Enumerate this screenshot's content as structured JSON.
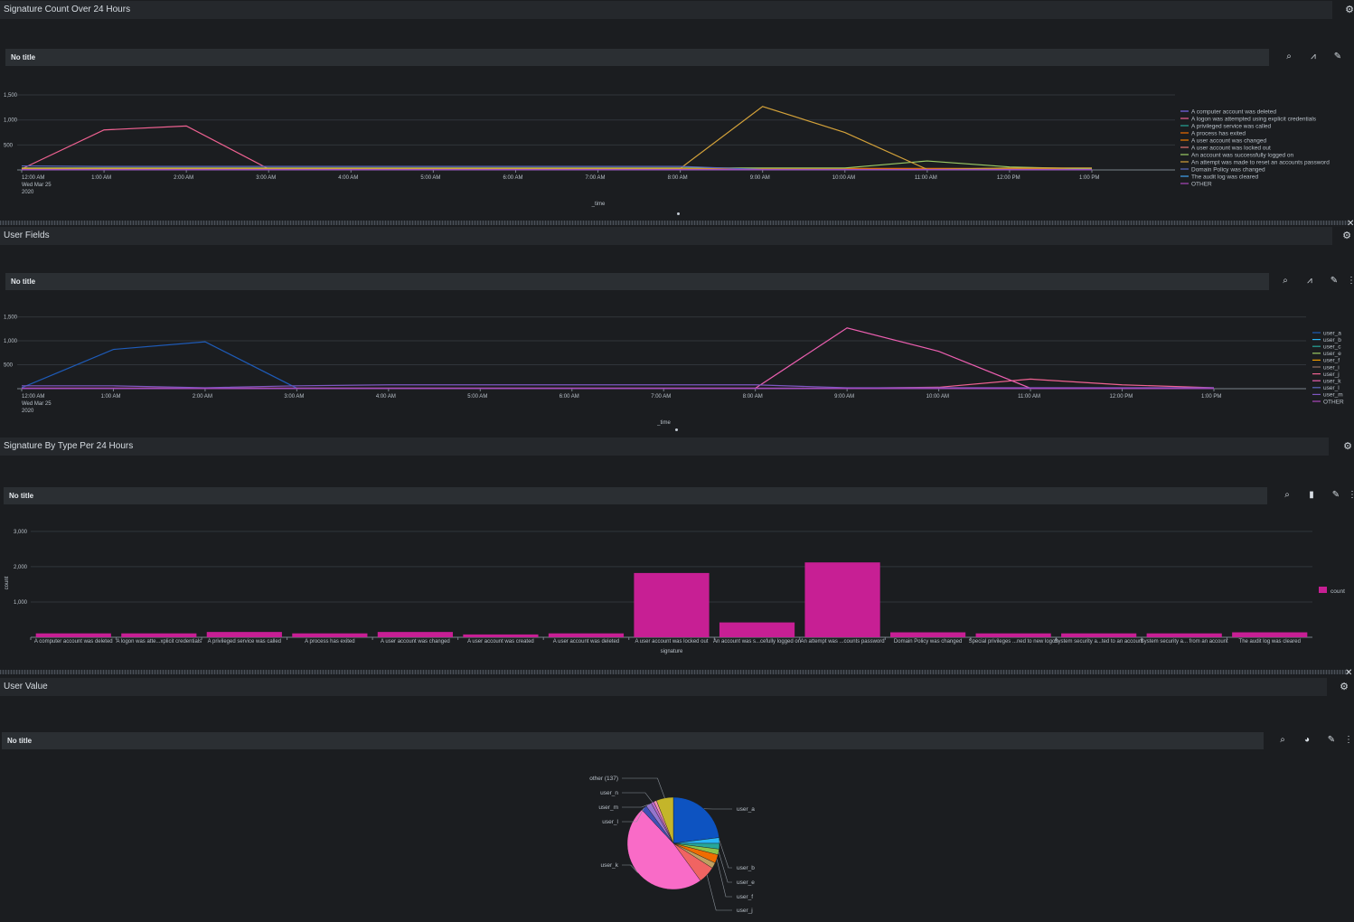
{
  "panels": {
    "p1": {
      "title": "Signature Count Over 24 Hours",
      "viz_title": "No title",
      "x_field": "_time",
      "x_ticks": [
        "12:00 AM",
        "1:00 AM",
        "2:00 AM",
        "3:00 AM",
        "4:00 AM",
        "5:00 AM",
        "6:00 AM",
        "7:00 AM",
        "8:00 AM",
        "9:00 AM",
        "10:00 AM",
        "11:00 AM",
        "12:00 PM",
        "1:00 PM"
      ],
      "x_tick_sub": [
        "Wed Mar 25",
        "2020"
      ],
      "y_ticks": [
        "500",
        "1,000",
        "1,500"
      ]
    },
    "p2": {
      "title": "User Fields",
      "viz_title": "No title",
      "x_field": "_time",
      "x_ticks": [
        "12:00 AM",
        "1:00 AM",
        "2:00 AM",
        "3:00 AM",
        "4:00 AM",
        "5:00 AM",
        "6:00 AM",
        "7:00 AM",
        "8:00 AM",
        "9:00 AM",
        "10:00 AM",
        "11:00 AM",
        "12:00 PM",
        "1:00 PM"
      ],
      "x_tick_sub": [
        "Wed Mar 25",
        "2020"
      ],
      "y_ticks": [
        "500",
        "1,000",
        "1,500"
      ]
    },
    "p3": {
      "title": "Signature By Type Per 24 Hours",
      "viz_title": "No title",
      "x_field": "signature",
      "y_field": "count",
      "y_ticks": [
        "1,000",
        "2,000",
        "3,000"
      ]
    },
    "p4": {
      "title": "User Value",
      "viz_title": "No title"
    }
  },
  "icons": {
    "settings": "gear-icon",
    "search": "search-icon",
    "chart_type_line": "line-chart-icon",
    "chart_type_bar": "bar-chart-icon",
    "chart_type_pie": "pie-chart-icon",
    "format": "paintbrush-icon",
    "more": "more-icon",
    "close": "close-icon"
  },
  "chart_data": [
    {
      "type": "line",
      "x": [
        "12:00 AM",
        "1:00 AM",
        "2:00 AM",
        "3:00 AM",
        "4:00 AM",
        "5:00 AM",
        "6:00 AM",
        "7:00 AM",
        "8:00 AM",
        "9:00 AM",
        "10:00 AM",
        "11:00 AM",
        "12:00 PM",
        "1:00 PM"
      ],
      "xlabel": "_time",
      "ylim": [
        0,
        1700
      ],
      "series": [
        {
          "name": "A computer account was deleted",
          "color": "#7b68ee",
          "values": [
            10,
            10,
            10,
            10,
            10,
            10,
            10,
            10,
            10,
            10,
            10,
            10,
            10,
            10
          ]
        },
        {
          "name": "A logon was attempted using explicit credentials",
          "color": "#f06292",
          "values": [
            20,
            800,
            880,
            20,
            20,
            20,
            20,
            20,
            20,
            20,
            20,
            20,
            20,
            20
          ]
        },
        {
          "name": "A privileged service was called",
          "color": "#26a69a",
          "values": [
            15,
            15,
            15,
            15,
            15,
            15,
            15,
            15,
            15,
            15,
            15,
            15,
            15,
            15
          ]
        },
        {
          "name": "A process has exited",
          "color": "#ef6c00",
          "values": [
            30,
            30,
            30,
            30,
            30,
            30,
            30,
            30,
            30,
            30,
            30,
            30,
            30,
            30
          ]
        },
        {
          "name": "A user account was changed",
          "color": "#f57c00",
          "values": [
            5,
            5,
            5,
            5,
            5,
            5,
            5,
            5,
            5,
            5,
            5,
            5,
            5,
            5
          ]
        },
        {
          "name": "A user account was locked out",
          "color": "#e57373",
          "values": [
            5,
            5,
            5,
            5,
            5,
            5,
            5,
            5,
            5,
            5,
            5,
            5,
            5,
            5
          ]
        },
        {
          "name": "An account was successfully logged on",
          "color": "#9ccc65",
          "values": [
            40,
            40,
            40,
            40,
            40,
            40,
            40,
            40,
            40,
            40,
            40,
            180,
            60,
            20
          ]
        },
        {
          "name": "An attempt was made to reset an accounts password",
          "color": "#d4a23a",
          "values": [
            30,
            30,
            30,
            30,
            30,
            30,
            30,
            30,
            30,
            1270,
            750,
            10,
            40,
            40
          ]
        },
        {
          "name": "Domain Policy was changed",
          "color": "#5c6bc0",
          "values": [
            80,
            70,
            70,
            70,
            70,
            70,
            70,
            70,
            70,
            10,
            10,
            10,
            10,
            10
          ]
        },
        {
          "name": "The audit log was cleared",
          "color": "#42a5f5",
          "values": [
            5,
            5,
            5,
            5,
            5,
            5,
            5,
            5,
            5,
            5,
            5,
            5,
            5,
            5
          ]
        },
        {
          "name": "OTHER",
          "color": "#ab47bc",
          "values": [
            5,
            5,
            5,
            5,
            5,
            5,
            5,
            5,
            5,
            5,
            5,
            5,
            5,
            5
          ]
        }
      ]
    },
    {
      "type": "line",
      "x": [
        "12:00 AM",
        "1:00 AM",
        "2:00 AM",
        "3:00 AM",
        "4:00 AM",
        "5:00 AM",
        "6:00 AM",
        "7:00 AM",
        "8:00 AM",
        "9:00 AM",
        "10:00 AM",
        "11:00 AM",
        "12:00 PM",
        "1:00 PM"
      ],
      "xlabel": "_time",
      "ylim": [
        0,
        1700
      ],
      "series": [
        {
          "name": "user_a",
          "color": "#1e5bb8",
          "values": [
            20,
            820,
            980,
            10,
            10,
            10,
            10,
            10,
            10,
            10,
            10,
            10,
            10,
            10
          ]
        },
        {
          "name": "user_b",
          "color": "#29b6f6",
          "values": [
            5,
            5,
            5,
            5,
            5,
            5,
            5,
            5,
            5,
            5,
            5,
            5,
            5,
            5
          ]
        },
        {
          "name": "user_c",
          "color": "#26a69a",
          "values": [
            5,
            5,
            5,
            5,
            5,
            5,
            5,
            5,
            5,
            5,
            5,
            5,
            5,
            5
          ]
        },
        {
          "name": "user_e",
          "color": "#9ccc65",
          "values": [
            5,
            5,
            5,
            5,
            5,
            5,
            5,
            5,
            5,
            5,
            5,
            5,
            5,
            5
          ]
        },
        {
          "name": "user_f",
          "color": "#ef9a00",
          "values": [
            5,
            5,
            5,
            5,
            5,
            5,
            5,
            5,
            5,
            5,
            5,
            5,
            5,
            5
          ]
        },
        {
          "name": "user_i",
          "color": "#8d6e63",
          "values": [
            5,
            5,
            5,
            5,
            5,
            5,
            5,
            5,
            5,
            5,
            5,
            5,
            5,
            5
          ]
        },
        {
          "name": "user_j",
          "color": "#f06292",
          "values": [
            10,
            10,
            10,
            10,
            10,
            10,
            10,
            10,
            10,
            10,
            30,
            200,
            80,
            20
          ]
        },
        {
          "name": "user_k",
          "color": "#ec5fb0",
          "values": [
            10,
            10,
            10,
            10,
            10,
            10,
            10,
            10,
            10,
            1270,
            780,
            10,
            10,
            10
          ]
        },
        {
          "name": "user_l",
          "color": "#5c6bc0",
          "values": [
            5,
            5,
            5,
            5,
            5,
            5,
            5,
            5,
            5,
            5,
            5,
            5,
            5,
            5
          ]
        },
        {
          "name": "user_m",
          "color": "#7e57c2",
          "values": [
            60,
            60,
            20,
            60,
            80,
            80,
            80,
            80,
            80,
            20,
            20,
            20,
            20,
            20
          ]
        },
        {
          "name": "OTHER",
          "color": "#ab47bc",
          "values": [
            5,
            5,
            5,
            5,
            5,
            5,
            5,
            5,
            5,
            5,
            5,
            5,
            5,
            5
          ]
        }
      ]
    },
    {
      "type": "bar",
      "categories": [
        "A computer account was deleted",
        "A logon was atte...xplicit credentials",
        "A privileged service was called",
        "A process has exited",
        "A user account was changed",
        "A user account was created",
        "A user account was deleted",
        "A user account was locked out",
        "An account was s...cefully logged on",
        "An attempt was ...counts password",
        "Domain Policy was changed",
        "Special privileges ...ned to new logon",
        "System security a...ted to an account",
        "System security a... from an account",
        "The audit log was cleared"
      ],
      "series": [
        {
          "name": "count",
          "color": "#c71f94",
          "values": [
            110,
            110,
            150,
            110,
            150,
            80,
            110,
            1820,
            420,
            2120,
            140,
            110,
            110,
            110,
            140
          ]
        }
      ],
      "xlabel": "signature",
      "ylabel": "count",
      "ylim": [
        0,
        3200
      ]
    },
    {
      "type": "pie",
      "slices": [
        {
          "label": "user_a",
          "value": 23,
          "color": "#0d53c1"
        },
        {
          "label": "user_b",
          "value": 2,
          "color": "#29b6f6"
        },
        {
          "label": "",
          "value": 2,
          "color": "#26a69a"
        },
        {
          "label": "user_e",
          "value": 2,
          "color": "#8bc34a"
        },
        {
          "label": "user_f",
          "value": 3,
          "color": "#ef6c00"
        },
        {
          "label": "",
          "value": 2,
          "color": "#c0a060"
        },
        {
          "label": "user_j",
          "value": 6,
          "color": "#f06462"
        },
        {
          "label": "user_k",
          "value": 48,
          "color": "#f96bc7"
        },
        {
          "label": "user_l",
          "value": 2,
          "color": "#3f51b5"
        },
        {
          "label": "user_m",
          "value": 2,
          "color": "#9575cd"
        },
        {
          "label": "user_n",
          "value": 1,
          "color": "#ba68c8"
        },
        {
          "label": "",
          "value": 1,
          "color": "#f48fb1"
        },
        {
          "label": "other (137)",
          "value": 6,
          "color": "#c4b52a"
        }
      ]
    }
  ]
}
